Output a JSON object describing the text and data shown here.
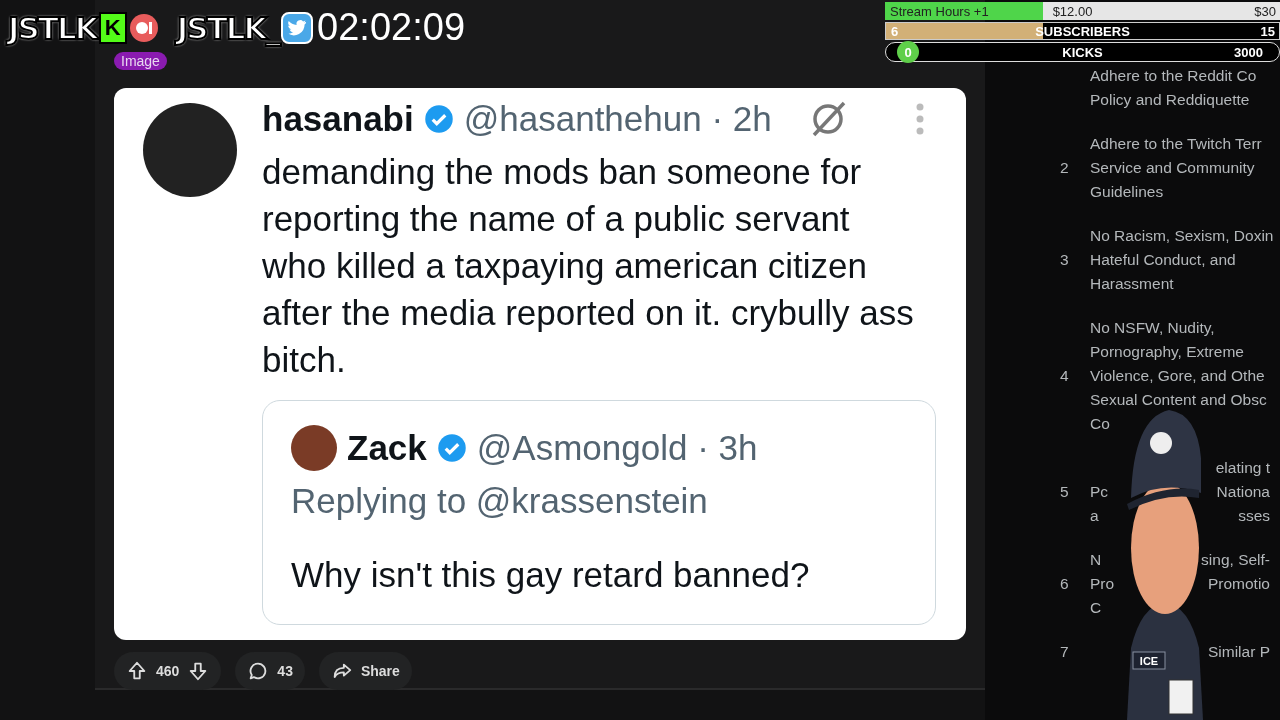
{
  "overlay": {
    "logos": [
      {
        "kind": "kick",
        "name": "JSTLK",
        "badge": "K"
      },
      {
        "kind": "twitter",
        "name": "JSTLK_"
      }
    ],
    "timer": "02:02:09",
    "goals": [
      {
        "kind": "money",
        "label": "Stream Hours +1",
        "current": "$12.00",
        "target": "$30",
        "level": 0.4
      },
      {
        "kind": "count",
        "current": "6",
        "label": "SUBSCRIBERS",
        "target": "15",
        "level": 0.4
      },
      {
        "kind": "pill",
        "current": "0",
        "label": "KICKS",
        "target": "3000",
        "level": 0
      }
    ],
    "character": {
      "badge": "ICE"
    }
  },
  "post": {
    "flair": "Image",
    "tweet": {
      "name": "hasanabi",
      "verified": true,
      "handle": "@hasanthehun · 2h",
      "text": "demanding the mods ban someone for reporting the name of a public servant who killed a taxpaying american citizen after the media reported on it. crybully ass bitch.",
      "quote": {
        "name": "Zack",
        "verified": true,
        "handle": "@Asmongold · 3h",
        "reply": "Replying to @krassenstein",
        "text": "Why isn't this gay retard banned?"
      }
    },
    "actions": {
      "score": "460",
      "comments": "43",
      "share": "Share"
    }
  },
  "sidebar": {
    "rules": [
      {
        "lines": [
          {
            "left": "Adhere to the Reddit Co"
          },
          {
            "left": "Policy and Reddiquette"
          }
        ]
      },
      {
        "number": "2",
        "lines": [
          {
            "left": "Adhere to the Twitch Terr"
          },
          {
            "left": "Service and Community"
          },
          {
            "left": "Guidelines"
          }
        ]
      },
      {
        "number": "3",
        "lines": [
          {
            "left": "No Racism, Sexism, Doxin"
          },
          {
            "left": "Hateful Conduct, and"
          },
          {
            "left": "Harassment"
          }
        ]
      },
      {
        "number": "4",
        "lines": [
          {
            "left": "No NSFW, Nudity,"
          },
          {
            "left": "Pornography, Extreme"
          },
          {
            "left": "Violence, Gore, and Othe"
          },
          {
            "left": "Sexual Content and Obsc"
          },
          {
            "left": "Co"
          }
        ]
      },
      {
        "number": "5",
        "lines": [
          {
            "right": "elating t"
          },
          {
            "left": "Pc",
            "right": "Nationa"
          },
          {
            "left": "a",
            "right": "sses"
          }
        ]
      },
      {
        "number": "6",
        "lines": [
          {
            "left": "N",
            "right": "sing, Self-"
          },
          {
            "left": "Pro",
            "right": "Promotio"
          },
          {
            "left": "C"
          }
        ]
      },
      {
        "number": "7",
        "lines": [
          {
            "right": "Similar P"
          }
        ]
      }
    ]
  }
}
